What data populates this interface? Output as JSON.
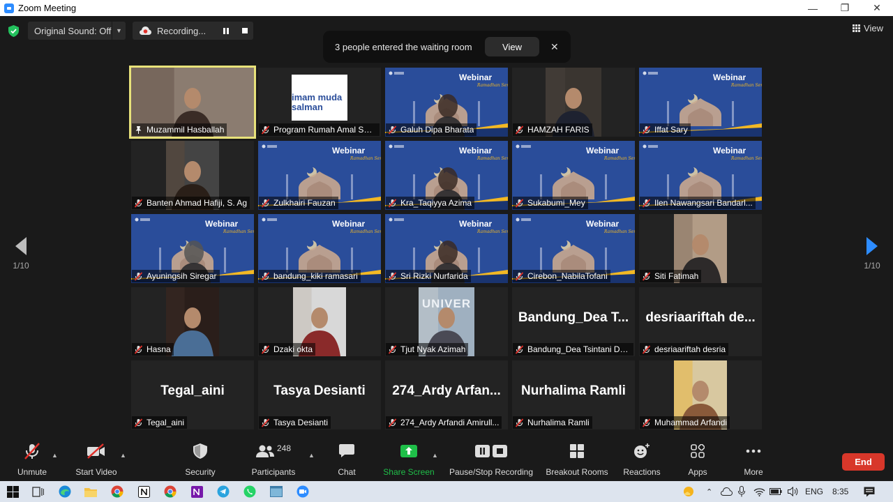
{
  "window": {
    "title": "Zoom Meeting"
  },
  "topbar": {
    "original_sound": "Original Sound: Off",
    "recording": "Recording...",
    "view": "View"
  },
  "notification": {
    "message": "3 people entered the waiting room",
    "view_button": "View"
  },
  "webinar_bg": {
    "title": "Webinar",
    "subtitle": "Ramadhan Series"
  },
  "participants": [
    {
      "name": "Muzammil Hasballah",
      "type": "video",
      "active": true
    },
    {
      "name": "Program Rumah Amal Sal...",
      "type": "logo",
      "logo_text": [
        "imam muda",
        "salman"
      ]
    },
    {
      "name": "Galuh Dipa Bharata",
      "type": "webinar"
    },
    {
      "name": "HAMZAH FARIS",
      "type": "video"
    },
    {
      "name": "Iffat Sary",
      "type": "webinar"
    },
    {
      "name": "Banten Ahmad Hafiji, S. Ag",
      "type": "video"
    },
    {
      "name": "Zulkhairi Fauzan",
      "type": "webinar"
    },
    {
      "name": "Kra_Taqiyya Azima",
      "type": "webinar"
    },
    {
      "name": "Sukabumi_Mey",
      "type": "webinar"
    },
    {
      "name": "Ilen Nawangsari Bandarl...",
      "type": "webinar"
    },
    {
      "name": "Ayuningsih Siregar",
      "type": "webinar"
    },
    {
      "name": "bandung_kiki ramasari",
      "type": "webinar"
    },
    {
      "name": "Sri Rizki Nurfarida",
      "type": "webinar"
    },
    {
      "name": "Cirebon_NabilaTofani",
      "type": "webinar"
    },
    {
      "name": "Siti Fatimah",
      "type": "video"
    },
    {
      "name": "Hasna",
      "type": "video"
    },
    {
      "name": "Dzaki okta",
      "type": "video"
    },
    {
      "name": "Tjut Nyak Azimah",
      "type": "video",
      "photo_text": "UNIVER"
    },
    {
      "name": "Bandung_Dea Tsintani Dz...",
      "type": "text",
      "display": "Bandung_Dea T..."
    },
    {
      "name": "desriaariftah desria",
      "type": "text",
      "display": "desriaariftah de..."
    },
    {
      "name": "Tegal_aini",
      "type": "text",
      "display": "Tegal_aini"
    },
    {
      "name": "Tasya Desianti",
      "type": "text",
      "display": "Tasya Desianti"
    },
    {
      "name": "274_Ardy Arfandi Amirull...",
      "type": "text",
      "display": "274_Ardy Arfan..."
    },
    {
      "name": "Nurhalima Ramli",
      "type": "text",
      "display": "Nurhalima Ramli"
    },
    {
      "name": "Muhammad Arfandi",
      "type": "video"
    }
  ],
  "pagination": {
    "left": "1/10",
    "right": "1/10"
  },
  "toolbar": {
    "unmute": "Unmute",
    "start_video": "Start Video",
    "security": "Security",
    "participants": "Participants",
    "participants_count": "248",
    "chat": "Chat",
    "share_screen": "Share Screen",
    "recording": "Pause/Stop Recording",
    "breakout": "Breakout Rooms",
    "reactions": "Reactions",
    "apps": "Apps",
    "more": "More",
    "end": "End"
  },
  "taskbar": {
    "lang": "ENG",
    "time": "8:35"
  },
  "colors": {
    "accent_blue": "#2d8cff",
    "share_green": "#1fbf49",
    "end_red": "#d8372a",
    "active_border": "#e8e27a",
    "webinar_blue": "#2a4d9a",
    "webinar_gold": "#f2b824"
  }
}
